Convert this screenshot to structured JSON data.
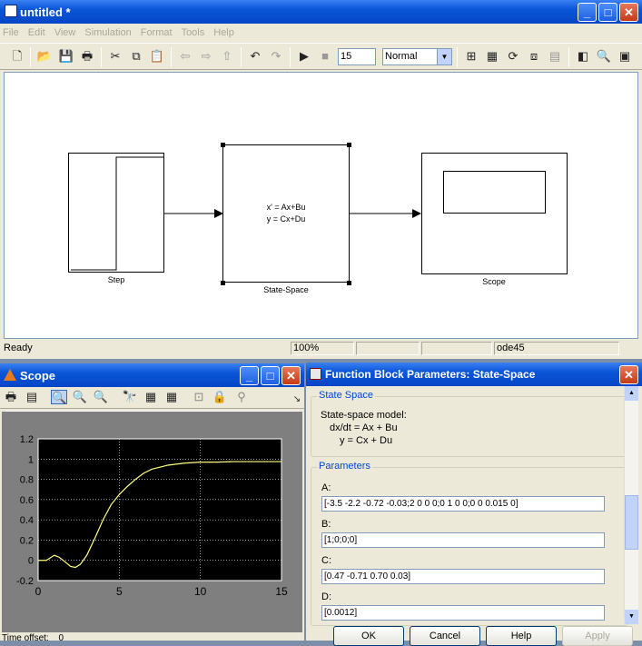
{
  "model_window": {
    "title": "untitled *",
    "menu": [
      "File",
      "Edit",
      "View",
      "Simulation",
      "Format",
      "Tools",
      "Help"
    ],
    "stop_time": "15",
    "sim_mode": "Normal",
    "blocks": {
      "step": "Step",
      "state_space": "State-Space",
      "state_space_eq1": "x' = Ax+Bu",
      "state_space_eq2": "y = Cx+Du",
      "scope": "Scope"
    },
    "status": {
      "ready": "Ready",
      "zoom": "100%",
      "solver": "ode45"
    }
  },
  "scope_window": {
    "title": "Scope",
    "time_offset_label": "Time offset:",
    "time_offset_value": "0"
  },
  "dialog": {
    "title": "Function Block Parameters: State-Space",
    "section_title": "State Space",
    "description_line1": "State-space model:",
    "description_line2": "dx/dt = Ax + Bu",
    "description_line3": "y = Cx + Du",
    "params_title": "Parameters",
    "fields": [
      {
        "label": "A:",
        "value": "[-3.5 -2.2 -0.72 -0.03;2 0 0 0;0 1 0 0;0 0 0.015 0]"
      },
      {
        "label": "B:",
        "value": "[1;0;0;0]"
      },
      {
        "label": "C:",
        "value": "[0.47 -0.71 0.70 0.03]"
      },
      {
        "label": "D:",
        "value": "[0.0012]"
      }
    ],
    "buttons": {
      "ok": "OK",
      "cancel": "Cancel",
      "help": "Help",
      "apply": "Apply"
    }
  },
  "chart_data": {
    "type": "line",
    "xlim": [
      0,
      15
    ],
    "ylim": [
      -0.2,
      1.2
    ],
    "xticks": [
      "0",
      "5",
      "10",
      "15"
    ],
    "yticks": [
      "-0.2",
      "0",
      "0.2",
      "0.4",
      "0.6",
      "0.8",
      "1",
      "1.2"
    ],
    "grid": true,
    "background": "#000000",
    "line_color": "#ffff80",
    "series": [
      {
        "x": [
          0,
          0.5,
          1,
          1.3,
          1.7,
          2,
          2.3,
          2.6,
          3,
          3.5,
          4,
          4.5,
          5,
          5.5,
          6,
          6.5,
          7,
          7.5,
          8,
          9,
          10,
          11,
          12,
          13,
          14,
          15
        ],
        "values": [
          0,
          0,
          0.05,
          0.03,
          -0.02,
          -0.06,
          -0.07,
          -0.04,
          0.05,
          0.22,
          0.4,
          0.55,
          0.65,
          0.73,
          0.8,
          0.86,
          0.9,
          0.92,
          0.94,
          0.96,
          0.97,
          0.97,
          0.975,
          0.975,
          0.975,
          0.975
        ]
      }
    ]
  }
}
